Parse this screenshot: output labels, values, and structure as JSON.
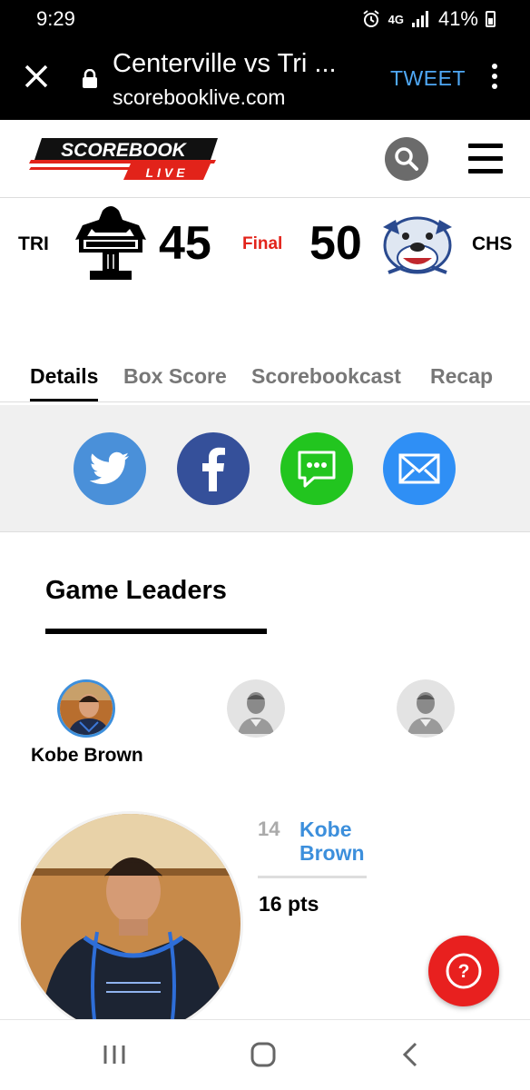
{
  "status_bar": {
    "time": "9:29",
    "network": "4G",
    "battery": "41%"
  },
  "browser": {
    "page_title": "Centerville vs Tri ...",
    "url": "scorebooklive.com",
    "tweet_label": "TWEET"
  },
  "site": {
    "logo_top": "SCOREBOOK",
    "logo_bottom": "LIVE"
  },
  "game": {
    "away_abbr": "TRI",
    "away_score": "45",
    "status": "Final",
    "home_score": "50",
    "home_abbr": "CHS"
  },
  "tabs": [
    "Details",
    "Box Score",
    "Scorebookcast",
    "Recap"
  ],
  "share": {
    "icons": [
      "twitter-icon",
      "facebook-icon",
      "sms-icon",
      "email-icon"
    ],
    "colors": {
      "twitter": "#4a90d9",
      "facebook": "#35509a",
      "sms": "#22c51f",
      "email": "#2f8ff5"
    }
  },
  "leaders": {
    "title": "Game Leaders",
    "selected_name": "Kobe Brown",
    "jersey": "14",
    "player_first": "Kobe",
    "player_last": "Brown",
    "stat": "16 pts"
  },
  "help_icon": "?",
  "accent": "#e2231a"
}
